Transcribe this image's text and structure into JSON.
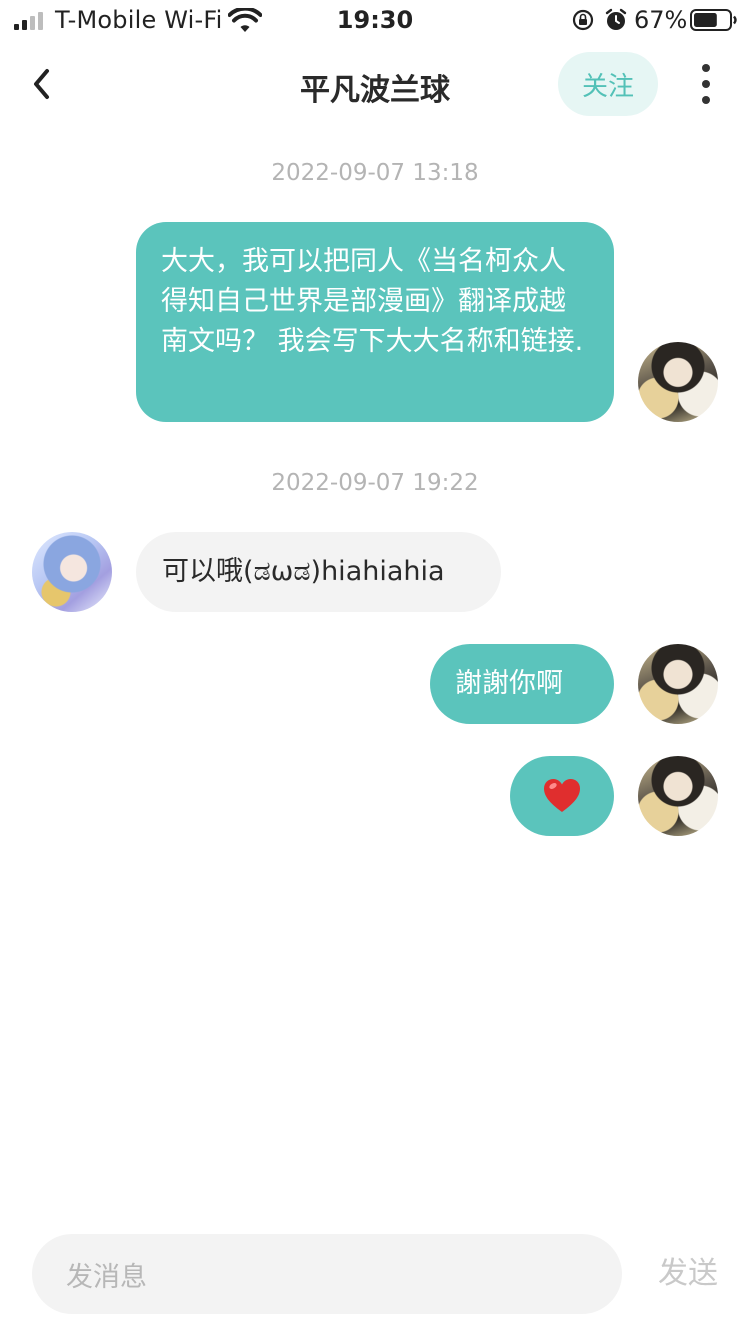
{
  "status_bar": {
    "carrier": "T-Mobile Wi-Fi",
    "time": "19:30",
    "battery_percent": "67%",
    "battery_level": 0.67
  },
  "header": {
    "title": "平凡波兰球",
    "follow_label": "关注"
  },
  "messages": [
    {
      "type": "timestamp",
      "text": "2022-09-07 13:18"
    },
    {
      "type": "message",
      "direction": "outgoing",
      "text": "大大，我可以把同人《当名柯众人得知自己世界是部漫画》翻译成越南文吗？ 我会写下大大名称和链接."
    },
    {
      "type": "timestamp",
      "text": "2022-09-07 19:22"
    },
    {
      "type": "message",
      "direction": "incoming",
      "text": "可以哦(ಡωಡ)hiahiahia"
    },
    {
      "type": "message",
      "direction": "outgoing",
      "text": "謝謝你啊"
    },
    {
      "type": "message",
      "direction": "outgoing",
      "emoji": "heart"
    }
  ],
  "input": {
    "placeholder": "发消息",
    "send_label": "发送"
  },
  "colors": {
    "accent": "#5bc4bc",
    "follow_bg": "#e6f6f4",
    "incoming_bubble": "#f3f3f3",
    "timestamp_text": "#b4b4b4"
  }
}
